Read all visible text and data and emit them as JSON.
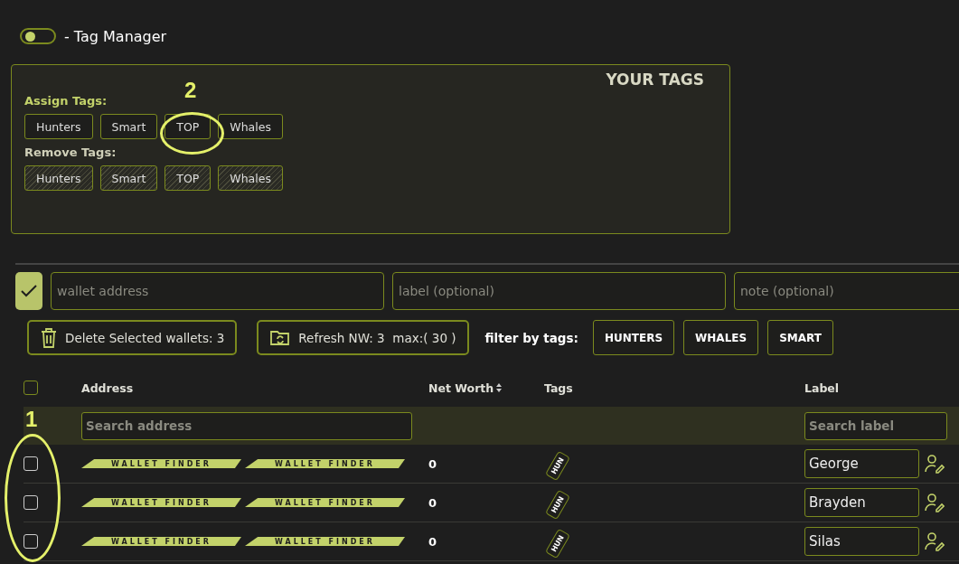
{
  "header": {
    "toggle": {
      "on": false
    },
    "title": "- Tag Manager"
  },
  "tag_panel": {
    "title": "YOUR TAGS",
    "assign_label": "Assign Tags:",
    "assign_tags": [
      "Hunters",
      "Smart",
      "TOP",
      "Whales"
    ],
    "remove_label": "Remove Tags:",
    "remove_tags": [
      "Hunters",
      "Smart",
      "TOP",
      "Whales"
    ]
  },
  "add_form": {
    "fields": [
      {
        "placeholder": "wallet address"
      },
      {
        "placeholder": "label (optional)"
      },
      {
        "placeholder": "note (optional)"
      }
    ]
  },
  "actions": {
    "delete_button": "Delete Selected wallets: 3",
    "refresh_button": "Refresh NW: 3  max:( 30 )",
    "filter_label": "filter by tags:",
    "filters": [
      {
        "label": "HUNTERS",
        "selected": false
      },
      {
        "label": "WHALES",
        "selected": false
      },
      {
        "label": "SMART",
        "selected": false
      }
    ]
  },
  "table": {
    "select_all": {
      "checked": false
    },
    "columns": [
      {
        "label": "Address",
        "sortable": false
      },
      {
        "label": "Net Worth",
        "sortable": true
      },
      {
        "label": "Tags",
        "sortable": false
      },
      {
        "label": "Label",
        "sortable": false
      }
    ],
    "search": {
      "address_placeholder": "Search address",
      "label_placeholder": "Search label"
    },
    "rows": [
      {
        "checked": false,
        "address_redaction": [
          "WALLET FINDER",
          "WALLET FINDER"
        ],
        "net_worth": "0",
        "tags": [
          "HUN"
        ],
        "label": "George"
      },
      {
        "checked": false,
        "address_redaction": [
          "WALLET FINDER",
          "WALLET FINDER"
        ],
        "net_worth": "0",
        "tags": [
          "HUN"
        ],
        "label": "Brayden"
      },
      {
        "checked": false,
        "address_redaction": [
          "WALLET FINDER",
          "WALLET FINDER"
        ],
        "net_worth": "0",
        "tags": [
          "HUN"
        ],
        "label": "Silas"
      }
    ]
  },
  "annotations": [
    {
      "text": "1",
      "kind": "rows"
    },
    {
      "text": "2",
      "kind": "tag"
    }
  ]
}
